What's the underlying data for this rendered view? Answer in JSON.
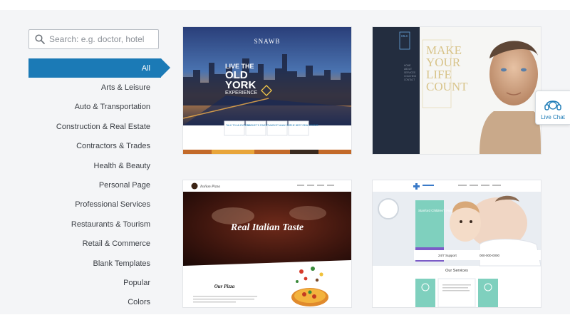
{
  "search": {
    "placeholder": "Search: e.g. doctor, hotel"
  },
  "categories": [
    "All",
    "Arts & Leisure",
    "Auto & Transportation",
    "Construction & Real Estate",
    "Contractors & Trades",
    "Health & Beauty",
    "Personal Page",
    "Professional Services",
    "Restaurants & Tourism",
    "Retail & Commerce",
    "Blank Templates",
    "Popular",
    "Colors"
  ],
  "templates": {
    "city": {
      "brand": "SNAWB",
      "line1": "LIVE THE",
      "line2": "OLD",
      "line3": "YORK",
      "line4": "EXPERIENCE",
      "buttons": [
        "TALK TO AN EXPERT",
        "MARKET'S FINEST",
        "MARKET ANALYSIS",
        "THE BEST REAL ESTATE"
      ]
    },
    "portrait": {
      "logo": "MLC",
      "menu": [
        "HOME",
        "ABOUT",
        "SERVICES",
        "COACHING",
        "CONTACT"
      ],
      "headline": [
        "MAKE",
        "YOUR",
        "LIFE",
        "COUNT"
      ]
    },
    "pizza": {
      "brand": "Italian Pizza",
      "hero": "Real Italian Taste",
      "section": "Our Pizza"
    },
    "hospital": {
      "hero": "Stanford Children's Hospital",
      "support": "24/7 Support",
      "phone": "000-000-0000",
      "section": "Our Services"
    }
  },
  "livechat": {
    "label": "Live Chat"
  },
  "colors": {
    "accent": "#1b7ab6",
    "navy": "#232d3f",
    "gold": "#d8c48a",
    "teal": "#7fd0be"
  }
}
